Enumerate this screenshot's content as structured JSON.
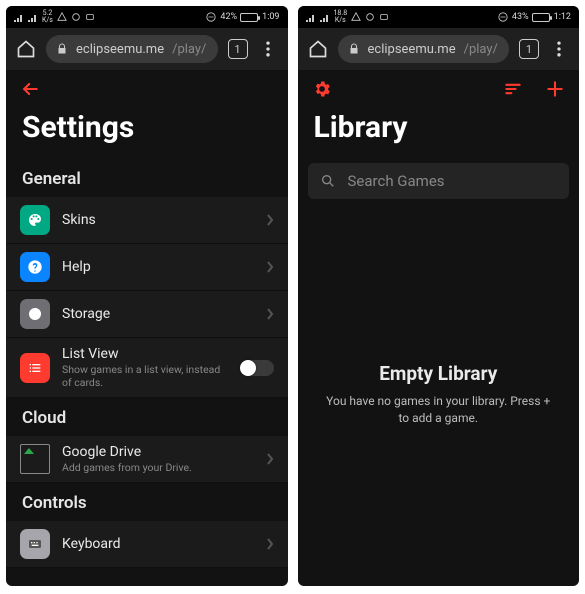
{
  "left": {
    "status": {
      "battery_pct": "42%",
      "time": "1:09",
      "net_rate_top": "5.2",
      "net_rate_bot": "K/s"
    },
    "browser": {
      "url_host": "eclipseemu.me",
      "url_path": "/play/",
      "tab_count": "1"
    },
    "title": "Settings",
    "sections": {
      "general": {
        "heading": "General",
        "items": [
          {
            "label": "Skins"
          },
          {
            "label": "Help"
          },
          {
            "label": "Storage"
          },
          {
            "label": "List View",
            "sub": "Show games in a list view, instead of cards."
          }
        ]
      },
      "cloud": {
        "heading": "Cloud",
        "items": [
          {
            "label": "Google Drive",
            "sub": "Add games from your Drive."
          }
        ]
      },
      "controls": {
        "heading": "Controls",
        "items": [
          {
            "label": "Keyboard"
          }
        ]
      }
    }
  },
  "right": {
    "status": {
      "battery_pct": "43%",
      "time": "1:12",
      "net_rate_top": "18.8",
      "net_rate_bot": "K/s"
    },
    "browser": {
      "url_host": "eclipseemu.me",
      "url_path": "/play/",
      "tab_count": "1"
    },
    "title": "Library",
    "search_placeholder": "Search Games",
    "empty": {
      "heading": "Empty Library",
      "body": "You have no games in your library. Press + to add a game."
    }
  }
}
